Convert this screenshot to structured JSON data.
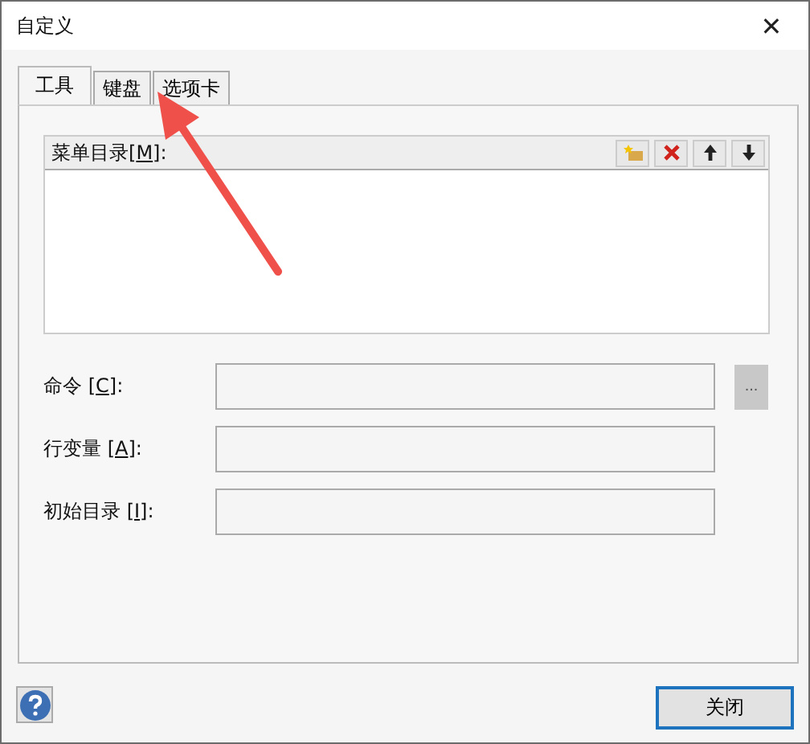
{
  "window": {
    "title": "自定义",
    "close_glyph": "✕"
  },
  "tabs": [
    {
      "label": "工具",
      "selected": true
    },
    {
      "label": "键盘",
      "selected": false
    },
    {
      "label": "选项卡",
      "selected": false
    }
  ],
  "menu_list": {
    "label": "菜单目录[",
    "key": "M",
    "suffix": "]:"
  },
  "menu_toolbar": [
    {
      "kind": "new"
    },
    {
      "kind": "delete"
    },
    {
      "kind": "up"
    },
    {
      "kind": "down"
    }
  ],
  "fields": [
    {
      "label": "命令 [",
      "key": "C",
      "suffix": "]:",
      "browse": true,
      "browse_label": "..."
    },
    {
      "label": "行变量 [",
      "key": "A",
      "suffix": "]:",
      "browse": false
    },
    {
      "label": "初始目录 [",
      "key": "I",
      "suffix": "]:",
      "browse": false
    }
  ],
  "close_button": "关闭",
  "annotation": {
    "kind": "arrow"
  }
}
